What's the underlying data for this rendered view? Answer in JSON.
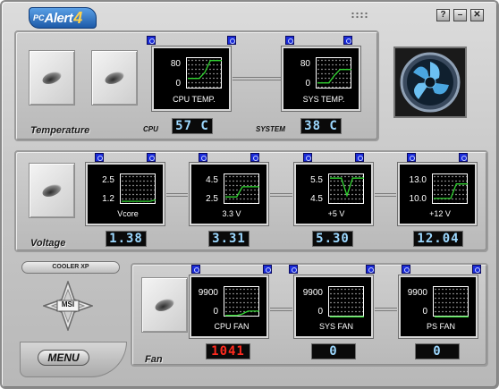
{
  "app": {
    "logo_prefix": "PC",
    "logo_name": "Alert",
    "logo_version": "4"
  },
  "window_buttons": {
    "help": "?",
    "minimize": "–",
    "close": "✕"
  },
  "temperature": {
    "section_label": "Temperature",
    "cpu_label": "CPU",
    "system_label": "SYSTEM",
    "monitors": [
      {
        "title": "CPU TEMP.",
        "high": "80",
        "low": "0",
        "trace": [
          0.35,
          0.35,
          0.35,
          0.55,
          0.95,
          0.95,
          0.95
        ]
      },
      {
        "title": "SYS TEMP.",
        "high": "80",
        "low": "0",
        "trace": [
          0.2,
          0.2,
          0.2,
          0.45,
          0.65,
          0.65,
          0.65
        ]
      }
    ],
    "readouts": {
      "cpu": "57 C",
      "system": "38 C"
    }
  },
  "voltage": {
    "section_label": "Voltage",
    "monitors": [
      {
        "title": "Vcore",
        "high": "2.5",
        "low": "1.2",
        "trace": [
          0.1,
          0.1,
          0.1,
          0.1,
          0.1,
          0.1,
          0.15
        ]
      },
      {
        "title": "3.3 V",
        "high": "4.5",
        "low": "2.5",
        "trace": [
          0.25,
          0.25,
          0.25,
          0.6,
          0.6,
          0.6,
          0.6
        ]
      },
      {
        "title": "+5 V",
        "high": "5.5",
        "low": "4.5",
        "trace": [
          0.9,
          0.9,
          0.9,
          0.3,
          0.9,
          0.9,
          0.9
        ]
      },
      {
        "title": "+12 V",
        "high": "13.0",
        "low": "10.0",
        "trace": [
          0.2,
          0.2,
          0.2,
          0.2,
          0.7,
          0.7,
          0.7
        ]
      }
    ],
    "readouts": [
      "1.38",
      "3.31",
      "5.30",
      "12.04"
    ]
  },
  "fan": {
    "section_label": "Fan",
    "monitors": [
      {
        "title": "CPU FAN",
        "high": "9900",
        "low": "0",
        "trace": [
          0.05,
          0.05,
          0.05,
          0.1,
          0.2,
          0.2,
          0.2
        ]
      },
      {
        "title": "SYS FAN",
        "high": "9900",
        "low": "0",
        "trace": [
          0.0,
          0.0,
          0.0,
          0.0,
          0.0,
          0.0,
          0.0
        ]
      },
      {
        "title": "PS FAN",
        "high": "9900",
        "low": "0",
        "trace": [
          0.0,
          0.0,
          0.0,
          0.0,
          0.0,
          0.0,
          0.0
        ]
      }
    ],
    "readouts": [
      "1041",
      "0",
      "0"
    ]
  },
  "cooler_xp_label": "COOLER XP",
  "msi_logo": "MSI",
  "menu_label": "MENU",
  "colors": {
    "trace": "#31d431",
    "lcd_text": "#9cd8ff",
    "lcd_alarm": "#ff2a1e",
    "corner_blue": "#1a2bd8"
  }
}
